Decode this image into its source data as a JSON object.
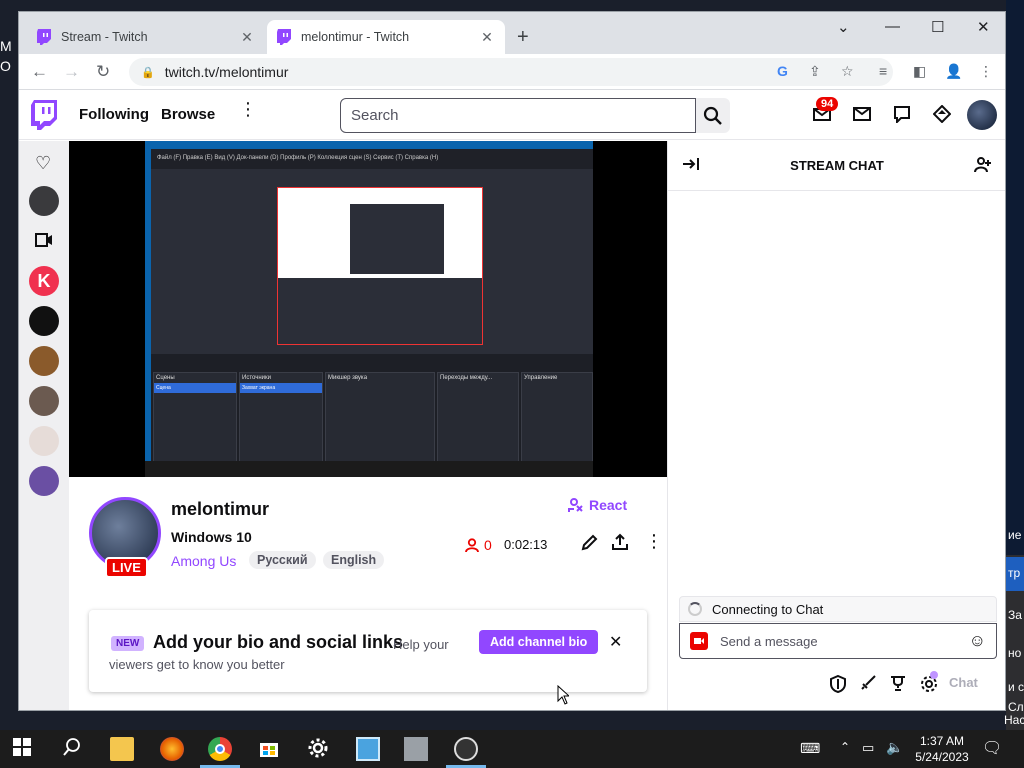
{
  "browser": {
    "tabs": [
      {
        "title": "Stream - Twitch",
        "active": false
      },
      {
        "title": "melontimur - Twitch",
        "active": true
      }
    ],
    "url": "twitch.tv/melontimur"
  },
  "twitch": {
    "nav": {
      "following": "Following",
      "browse": "Browse",
      "search_placeholder": "Search",
      "notifications_count": "94"
    },
    "channel": {
      "name": "melontimur",
      "title": "Windows 10",
      "game": "Among Us",
      "tags": [
        "Русский",
        "English"
      ],
      "live_label": "LIVE",
      "react_label": "React",
      "viewers": "0",
      "uptime": "0:02:13"
    },
    "bio_card": {
      "new_label": "NEW",
      "heading": "Add your bio and social links",
      "sub_line1": "Help your",
      "sub_line2": "viewers get to know you better",
      "button": "Add channel bio"
    },
    "chat": {
      "title": "STREAM CHAT",
      "connecting": "Connecting to Chat",
      "placeholder": "Send a message",
      "chat_button": "Chat"
    }
  },
  "obs": {
    "menu": "Файл (F)   Правка (E)   Вид (V)   Док-панели (D)   Профиль (P)   Коллекция сцен (S)   Сервис (T)   Справка (H)",
    "panels": [
      "Сцены",
      "Источники",
      "Микшер звука",
      "Переходы между...",
      "Управление"
    ],
    "scene_item": "Сцена",
    "source_item": "Захват экрана"
  },
  "desktop": {
    "right_texts": [
      "ие",
      "тр",
      "За",
      "но",
      "и ст",
      "Сл",
      "Настро"
    ],
    "left_texts": [
      "М",
      "О"
    ]
  },
  "taskbar": {
    "time": "1:37 AM",
    "date": "5/24/2023"
  },
  "colors": {
    "twitch_purple": "#9147ff",
    "live_red": "#eb0400"
  }
}
